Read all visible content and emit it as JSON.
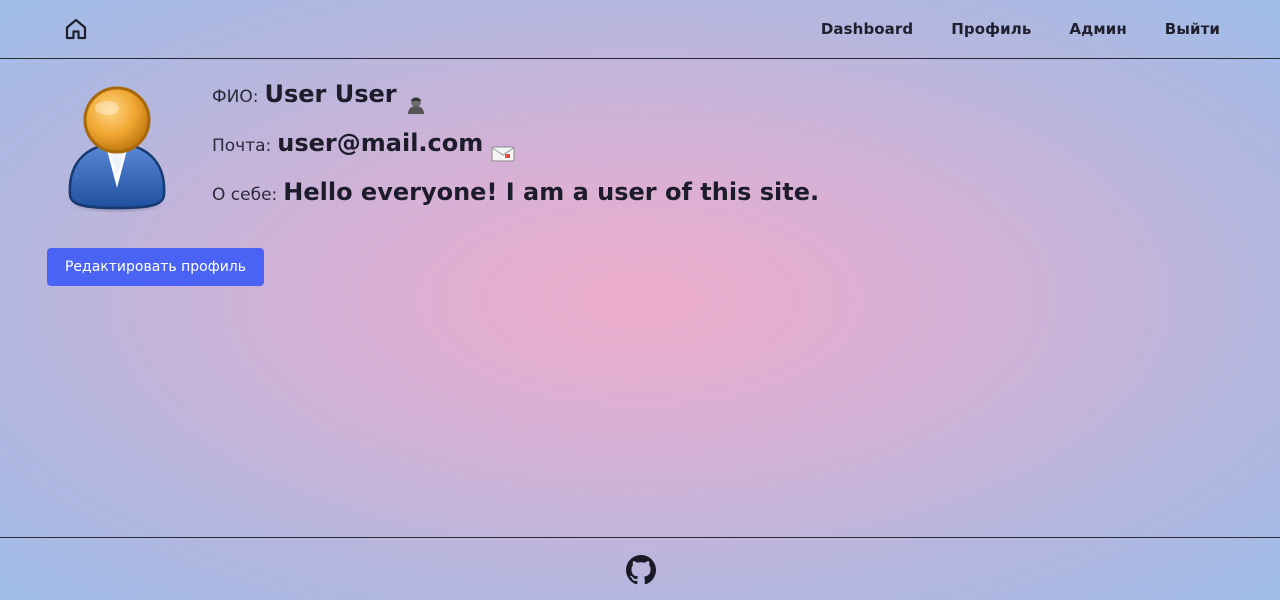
{
  "header": {
    "home_icon": "home-icon",
    "nav": [
      {
        "label": "Dashboard"
      },
      {
        "label": "Профиль"
      },
      {
        "label": "Админ"
      },
      {
        "label": "Выйти"
      }
    ]
  },
  "profile": {
    "avatar_icon": "user-avatar-icon",
    "name_label": "ФИО:",
    "name_value": "User User",
    "name_emoji": "person-emoji-icon",
    "email_label": "Почта:",
    "email_value": "user@mail.com",
    "email_emoji": "envelope-emoji-icon",
    "about_label": "О себе:",
    "about_value": "Hello everyone! I am a user of this site."
  },
  "actions": {
    "edit_label": "Редактировать профиль"
  },
  "footer": {
    "github_icon": "github-icon"
  },
  "colors": {
    "accent": "#4a63f5",
    "text": "#1f1f2e",
    "bg_center": "#eeaccb",
    "bg_edge": "#9ebde9"
  }
}
